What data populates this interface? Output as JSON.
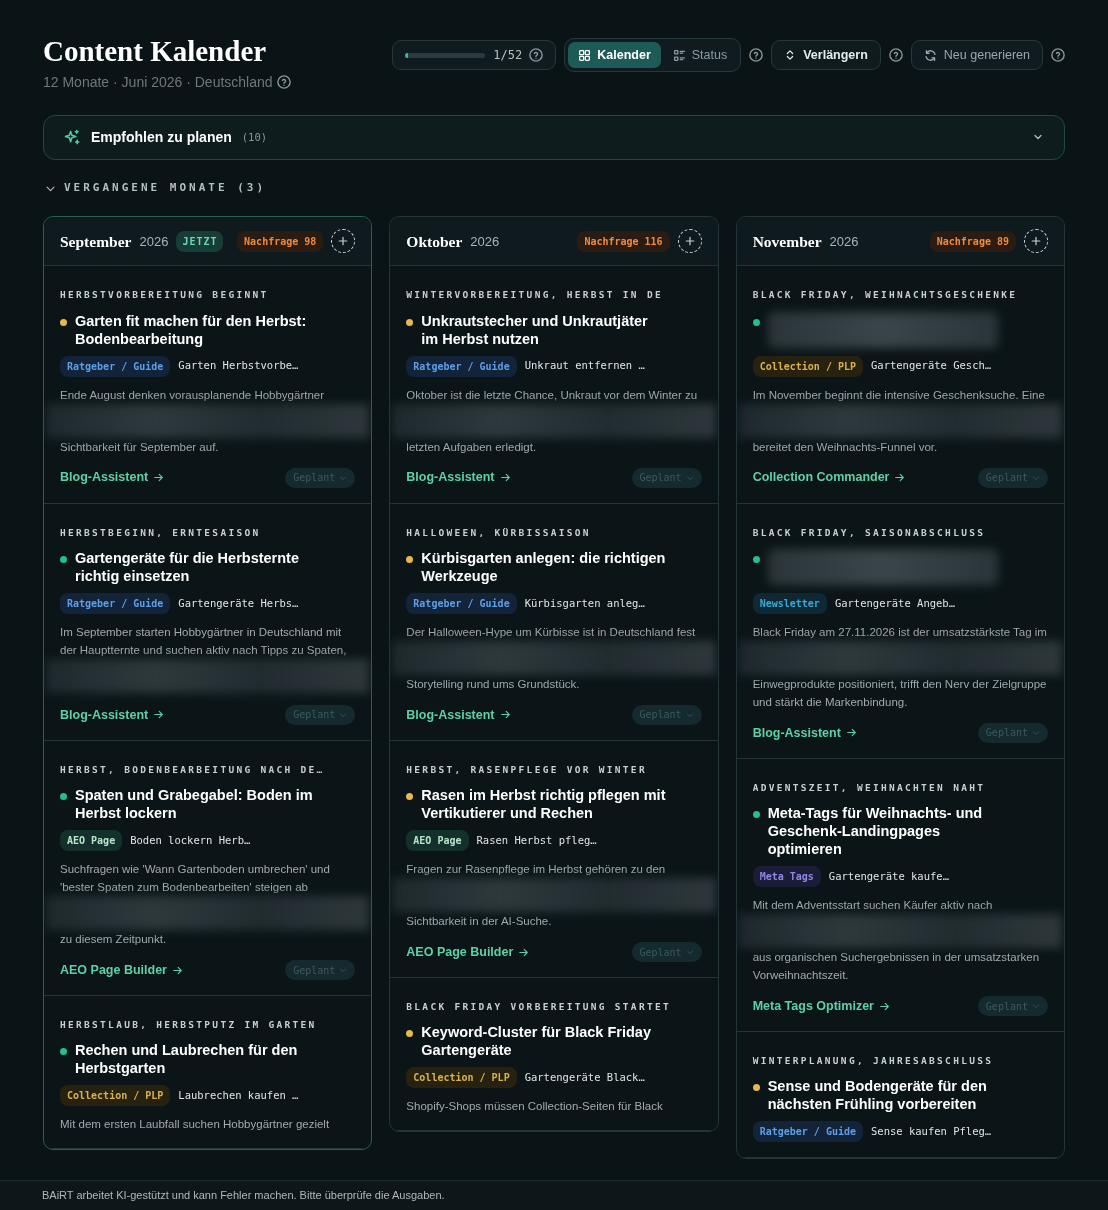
{
  "header": {
    "title": "Content Kalender",
    "subtitle": "12 Monate · Juni 2026 · Deutschland",
    "progress": {
      "level": 0.03,
      "reading": "1/52"
    },
    "view_tabs": [
      {
        "label": "Kalender",
        "kind": "grid",
        "selected": true
      },
      {
        "label": "Status",
        "kind": "list",
        "selected": false
      }
    ],
    "extend_button": "Verlängern",
    "regenerate_button": "Neu generieren"
  },
  "recommended": {
    "label": "Empfohlen zu planen",
    "count": "(10)",
    "expanded": false
  },
  "past_months": {
    "label": "VERGANGENE MONATE (3)",
    "expanded": true
  },
  "months": [
    {
      "name": "September",
      "year": "2026",
      "now_badge": "JETZT",
      "demand": "Nachfrage 98",
      "cards": [
        {
          "topics": "HERBSTVORBEREITUNG BEGINNT",
          "color": "#e8b84a",
          "title": "Garten fit machen für den Herbst: Bodenbearbeitung",
          "type": {
            "kind": "guide",
            "label": "Ratgeber / Guide"
          },
          "keyword": "Garten Herbstvorbe…",
          "desc": [
            {
              "kind": "text",
              "text": "Ende August denken vorausplanende Hobbygärtner"
            },
            {
              "kind": "blur"
            },
            {
              "kind": "text",
              "text": "Sichtbarkeit für September auf."
            }
          ],
          "tool_link": "Blog-Assistent",
          "status": "Geplant"
        },
        {
          "topics": "HERBSTBEGINN, ERNTESAISON",
          "color": "#22c08a",
          "title": "Gartengeräte für die Herbsternte richtig einsetzen",
          "type": {
            "kind": "guide",
            "label": "Ratgeber / Guide"
          },
          "keyword": "Gartengeräte Herbs…",
          "desc": [
            {
              "kind": "text",
              "text": "Im September starten Hobbygärtner in Deutschland mit der Hauptternte und suchen aktiv nach Tipps zu Spaten,"
            },
            {
              "kind": "blur"
            }
          ],
          "tool_link": "Blog-Assistent",
          "status": "Geplant"
        },
        {
          "topics": "HERBST, BODENBEARBEITUNG NACH DE…",
          "color": "#22c08a",
          "title": "Spaten und Grabegabel: Boden im Herbst lockern",
          "type": {
            "kind": "aeo",
            "label": "AEO Page"
          },
          "keyword": "Boden lockern Herb…",
          "desc": [
            {
              "kind": "text",
              "text": "Suchfragen wie 'Wann Gartenboden umbrechen' und 'bester Spaten zum Bodenbearbeiten' steigen ab"
            },
            {
              "kind": "blur"
            },
            {
              "kind": "text",
              "text": "zu diesem Zeitpunkt."
            }
          ],
          "tool_link": "AEO Page Builder",
          "status": "Geplant"
        },
        {
          "topics": "HERBSTLAUB, HERBSTPUTZ IM GARTEN",
          "color": "#22c08a",
          "title": "Rechen und Laubrechen für den Herbstgarten",
          "type": {
            "kind": "collection",
            "label": "Collection / PLP"
          },
          "keyword": "Laubrechen kaufen …",
          "desc": [
            {
              "kind": "text",
              "text": "Mit dem ersten Laubfall suchen Hobbygärtner gezielt"
            }
          ]
        }
      ]
    },
    {
      "name": "Oktober",
      "year": "2026",
      "demand": "Nachfrage 116",
      "cards": [
        {
          "topics": "WINTERVORBEREITUNG, HERBST IN DE",
          "color": "#e8b84a",
          "title": "Unkrautstecher und Unkrautjäter im Herbst nutzen",
          "type": {
            "kind": "guide",
            "label": "Ratgeber / Guide"
          },
          "keyword": "Unkraut entfernen …",
          "desc": [
            {
              "kind": "text",
              "text": "Oktober ist die letzte Chance, Unkraut vor dem Winter zu"
            },
            {
              "kind": "blur"
            },
            {
              "kind": "text",
              "text": "letzten Aufgaben erledigt."
            }
          ],
          "tool_link": "Blog-Assistent",
          "status": "Geplant"
        },
        {
          "topics": "HALLOWEEN, KÜRBISSAISON",
          "color": "#e8b84a",
          "title": "Kürbisgarten anlegen: die richtigen Werkzeuge",
          "type": {
            "kind": "guide",
            "label": "Ratgeber / Guide"
          },
          "keyword": "Kürbisgarten anleg…",
          "desc": [
            {
              "kind": "text",
              "text": "Der Halloween-Hype um Kürbisse ist in Deutschland fest"
            },
            {
              "kind": "blur"
            },
            {
              "kind": "text",
              "text": "Storytelling rund ums Grundstück."
            }
          ],
          "tool_link": "Blog-Assistent",
          "status": "Geplant"
        },
        {
          "topics": "HERBST, RASENPFLEGE VOR WINTER",
          "color": "#e8b84a",
          "title": "Rasen im Herbst richtig pflegen mit Vertikutierer und Rechen",
          "type": {
            "kind": "aeo",
            "label": "AEO Page"
          },
          "keyword": "Rasen Herbst pfleg…",
          "desc": [
            {
              "kind": "text",
              "text": "Fragen zur Rasenpflege im Herbst gehören zu den"
            },
            {
              "kind": "blur"
            },
            {
              "kind": "text",
              "text": "Sichtbarkeit in der AI-Suche."
            }
          ],
          "tool_link": "AEO Page Builder",
          "status": "Geplant"
        },
        {
          "topics": "BLACK FRIDAY VORBEREITUNG STARTET",
          "color": "#e8b84a",
          "title": "Keyword-Cluster für Black Friday Gartengeräte",
          "type": {
            "kind": "collection",
            "label": "Collection / PLP"
          },
          "keyword": "Gartengeräte Black…",
          "desc": [
            {
              "kind": "text",
              "text": "Shopify-Shops müssen Collection-Seiten für Black"
            }
          ]
        }
      ]
    },
    {
      "name": "November",
      "year": "2026",
      "demand": "Nachfrage 89",
      "cards": [
        {
          "topics": "BLACK FRIDAY, WEIHNACHTSGESCHENKE",
          "color": "#22c08a",
          "title_blurred": true,
          "type": {
            "kind": "collection",
            "label": "Collection / PLP"
          },
          "keyword": "Gartengeräte Gesch…",
          "desc": [
            {
              "kind": "text",
              "text": "Im November beginnt die intensive Geschenksuche. Eine"
            },
            {
              "kind": "blur"
            },
            {
              "kind": "text",
              "text": "bereitet den Weihnachts-Funnel vor."
            }
          ],
          "tool_link": "Collection Commander",
          "status": "Geplant"
        },
        {
          "topics": "BLACK FRIDAY, SAISONABSCHLUSS",
          "color": "#22c08a",
          "title_blurred": true,
          "type": {
            "kind": "newsletter",
            "label": "Newsletter"
          },
          "keyword": "Gartengeräte Angeb…",
          "desc": [
            {
              "kind": "text",
              "text": "Black Friday am 27.11.2026 ist der umsatzstärkste Tag im"
            },
            {
              "kind": "blur"
            },
            {
              "kind": "text",
              "text": "Einwegprodukte positioniert, trifft den Nerv der Zielgruppe und stärkt die Markenbindung."
            }
          ],
          "tool_link": "Blog-Assistent",
          "status": "Geplant"
        },
        {
          "topics": "ADVENTSZEIT, WEIHNACHTEN NAHT",
          "color": "#22c08a",
          "title": "Meta-Tags für Weihnachts- und Geschenk-Landingpages optimieren",
          "type": {
            "kind": "meta",
            "label": "Meta Tags"
          },
          "keyword": "Gartengeräte kaufe…",
          "desc": [
            {
              "kind": "text",
              "text": "Mit dem Adventsstart suchen Käufer aktiv nach"
            },
            {
              "kind": "blur"
            },
            {
              "kind": "text",
              "text": "aus organischen Suchergebnissen in der umsatzstarken Vorweihnachtszeit."
            }
          ],
          "tool_link": "Meta Tags Optimizer",
          "status": "Geplant"
        },
        {
          "topics": "WINTERPLANUNG, JAHRESABSCHLUSS",
          "color": "#e8b84a",
          "title": "Sense und Bodengeräte für den nächsten Frühling vorbereiten",
          "type": {
            "kind": "guide",
            "label": "Ratgeber / Guide"
          },
          "keyword": "Sense kaufen Pfleg…"
        }
      ]
    }
  ],
  "footer": "BAiRT arbeitet KI-gestützt und kann Fehler machen. Bitte überprüfe die Ausgaben."
}
